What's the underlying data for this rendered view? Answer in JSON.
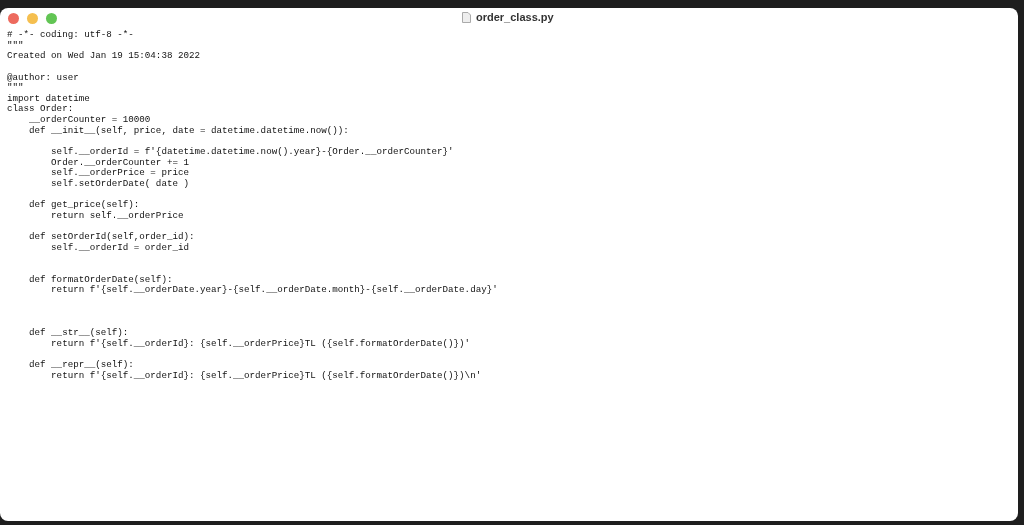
{
  "window": {
    "title": "order_class.py"
  },
  "code": [
    {
      "kind": "code",
      "text": "# -*- coding: utf-8 -*-"
    },
    {
      "kind": "code",
      "text": "\"\"\""
    },
    {
      "kind": "code",
      "text": "Created on Wed Jan 19 15:04:38 2022"
    },
    {
      "kind": "blank"
    },
    {
      "kind": "code",
      "text": "@author: user"
    },
    {
      "kind": "code",
      "text": "\"\"\""
    },
    {
      "kind": "code",
      "text": "import datetime"
    },
    {
      "kind": "code",
      "text": "class Order:"
    },
    {
      "kind": "code",
      "text": "    __orderCounter = 10000"
    },
    {
      "kind": "code",
      "text": "    def __init__(self, price, date = datetime.datetime.now()):"
    },
    {
      "kind": "blank"
    },
    {
      "kind": "code",
      "text": "        self.__orderId = f'{datetime.datetime.now().year}-{Order.__orderCounter}'"
    },
    {
      "kind": "code",
      "text": "        Order.__orderCounter += 1"
    },
    {
      "kind": "code",
      "text": "        self.__orderPrice = price"
    },
    {
      "kind": "code",
      "text": "        self.setOrderDate( date )"
    },
    {
      "kind": "blank"
    },
    {
      "kind": "code",
      "text": "    def get_price(self):"
    },
    {
      "kind": "code",
      "text": "        return self.__orderPrice"
    },
    {
      "kind": "blank"
    },
    {
      "kind": "code",
      "text": "    def setOrderId(self,order_id):"
    },
    {
      "kind": "code",
      "text": "        self.__orderId = order_id"
    },
    {
      "kind": "blank"
    },
    {
      "kind": "blank"
    },
    {
      "kind": "code",
      "text": "    def formatOrderDate(self):"
    },
    {
      "kind": "code",
      "text": "        return f'{self.__orderDate.year}-{self.__orderDate.month}-{self.__orderDate.day}'"
    },
    {
      "kind": "blank"
    },
    {
      "kind": "blank"
    },
    {
      "kind": "blank"
    },
    {
      "kind": "code",
      "text": "    def __str__(self):"
    },
    {
      "kind": "code",
      "text": "        return f'{self.__orderId}: {self.__orderPrice}TL ({self.formatOrderDate()})'"
    },
    {
      "kind": "blank"
    },
    {
      "kind": "code",
      "text": "    def __repr__(self):"
    },
    {
      "kind": "code",
      "text": "        return f'{self.__orderId}: {self.__orderPrice}TL ({self.formatOrderDate()})\\n'"
    }
  ]
}
